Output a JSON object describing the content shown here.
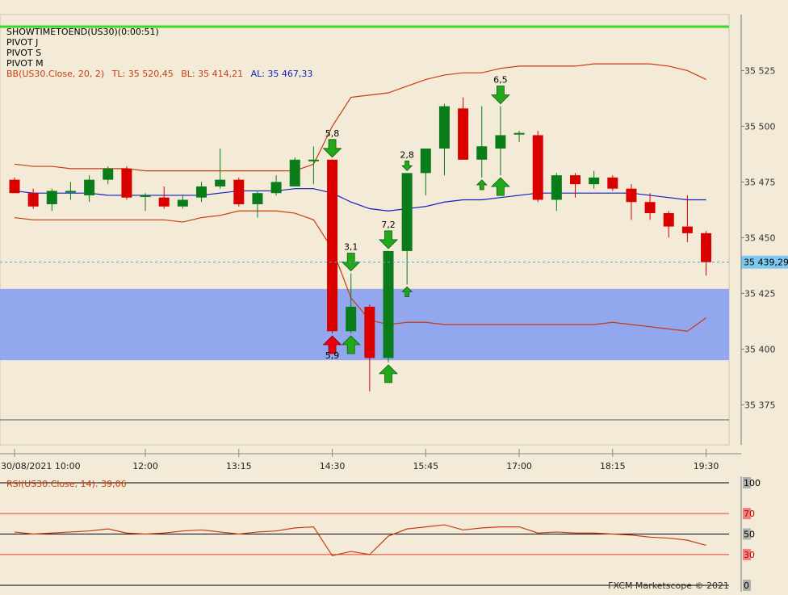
{
  "colors": {
    "background": "#f3ead7",
    "bull": "#0a7d1a",
    "bear": "#d90000",
    "bb": "#c83c10",
    "ma": "#1020c0",
    "zone": "#93a7ee",
    "top_line": "#33dd22",
    "rsi": "#c83c10",
    "price_badge": "#7ec8f0"
  },
  "header": {
    "line1": "SHOWTIMETOEND(US30)(0:00:51)",
    "line2": "PIVOT J",
    "line3": "PIVOT S",
    "line4": "PIVOT M",
    "bb_label": "BB(US30.Close, 20, 2)",
    "tl_label": "TL: 35 520,45",
    "bl_label": "BL: 35 414,21",
    "al_label": "AL: 35 467,33"
  },
  "current_price_label": "35 439,29",
  "watermark": "FXCM Marketscope © 2021",
  "chart_data": [
    {
      "type": "candlestick",
      "title": "",
      "x_tick_labels": [
        "30/08/2021 10:00",
        "12:00",
        "13:15",
        "14:30",
        "15:45",
        "17:00",
        "18:15",
        "19:30"
      ],
      "x_tick_candle_index": [
        0,
        7,
        12,
        17,
        22,
        27,
        32,
        37
      ],
      "y_ticks": [
        35375,
        35400,
        35425,
        35450,
        35475,
        35500,
        35525
      ],
      "y_tick_labels": [
        "35 375",
        "35 400",
        "35 425",
        "35 450",
        "35 475",
        "35 500",
        "35 525"
      ],
      "ylim": [
        35357,
        35544
      ],
      "grid": false,
      "candles": [
        {
          "o": 35476,
          "h": 35477,
          "l": 35470,
          "c": 35470
        },
        {
          "o": 35470,
          "h": 35472,
          "l": 35463,
          "c": 35464
        },
        {
          "o": 35465,
          "h": 35472,
          "l": 35462,
          "c": 35471
        },
        {
          "o": 35471,
          "h": 35475,
          "l": 35467,
          "c": 35471
        },
        {
          "o": 35469,
          "h": 35478,
          "l": 35466,
          "c": 35476
        },
        {
          "o": 35476,
          "h": 35482,
          "l": 35474,
          "c": 35481
        },
        {
          "o": 35481,
          "h": 35482,
          "l": 35467,
          "c": 35468
        },
        {
          "o": 35469,
          "h": 35470,
          "l": 35462,
          "c": 35469
        },
        {
          "o": 35468,
          "h": 35473,
          "l": 35463,
          "c": 35464
        },
        {
          "o": 35464,
          "h": 35469,
          "l": 35463,
          "c": 35467
        },
        {
          "o": 35468,
          "h": 35475,
          "l": 35466,
          "c": 35473
        },
        {
          "o": 35473,
          "h": 35490,
          "l": 35472,
          "c": 35476
        },
        {
          "o": 35476,
          "h": 35477,
          "l": 35464,
          "c": 35465
        },
        {
          "o": 35465,
          "h": 35471,
          "l": 35459,
          "c": 35470
        },
        {
          "o": 35470,
          "h": 35478,
          "l": 35469,
          "c": 35475
        },
        {
          "o": 35473,
          "h": 35486,
          "l": 35473,
          "c": 35485
        },
        {
          "o": 35485,
          "h": 35491,
          "l": 35474,
          "c": 35485
        },
        {
          "o": 35485,
          "h": 35485,
          "l": 35407,
          "c": 35408
        },
        {
          "o": 35408,
          "h": 35434,
          "l": 35407,
          "c": 35419
        },
        {
          "o": 35419,
          "h": 35420,
          "l": 35381,
          "c": 35396
        },
        {
          "o": 35396,
          "h": 35444,
          "l": 35394,
          "c": 35444
        },
        {
          "o": 35444,
          "h": 35479,
          "l": 35429,
          "c": 35479
        },
        {
          "o": 35479,
          "h": 35490,
          "l": 35469,
          "c": 35490
        },
        {
          "o": 35490,
          "h": 35510,
          "l": 35478,
          "c": 35509
        },
        {
          "o": 35508,
          "h": 35513,
          "l": 35485,
          "c": 35485
        },
        {
          "o": 35485,
          "h": 35509,
          "l": 35477,
          "c": 35491
        },
        {
          "o": 35490,
          "h": 35509,
          "l": 35478,
          "c": 35496
        },
        {
          "o": 35497,
          "h": 35498,
          "l": 35493,
          "c": 35497
        },
        {
          "o": 35496,
          "h": 35498,
          "l": 35466,
          "c": 35467
        },
        {
          "o": 35467,
          "h": 35479,
          "l": 35462,
          "c": 35478
        },
        {
          "o": 35478,
          "h": 35479,
          "l": 35468,
          "c": 35474
        },
        {
          "o": 35474,
          "h": 35480,
          "l": 35472,
          "c": 35477
        },
        {
          "o": 35477,
          "h": 35478,
          "l": 35471,
          "c": 35472
        },
        {
          "o": 35472,
          "h": 35474,
          "l": 35458,
          "c": 35466
        },
        {
          "o": 35466,
          "h": 35470,
          "l": 35458,
          "c": 35461
        },
        {
          "o": 35461,
          "h": 35462,
          "l": 35450,
          "c": 35455
        },
        {
          "o": 35455,
          "h": 35469,
          "l": 35448,
          "c": 35452
        },
        {
          "o": 35452,
          "h": 35453,
          "l": 35433,
          "c": 35439
        }
      ],
      "bb_upper": [
        35483,
        35482,
        35482,
        35481,
        35481,
        35481,
        35481,
        35480,
        35480,
        35480,
        35480,
        35480,
        35480,
        35480,
        35480,
        35480,
        35483,
        35500,
        35513,
        35514,
        35515,
        35518,
        35521,
        35523,
        35524,
        35524,
        35526,
        35527,
        35527,
        35527,
        35527,
        35528,
        35528,
        35528,
        35528,
        35527,
        35525,
        35521
      ],
      "bb_lower": [
        35459,
        35458,
        35458,
        35458,
        35458,
        35458,
        35458,
        35458,
        35458,
        35457,
        35459,
        35460,
        35462,
        35462,
        35462,
        35461,
        35458,
        35445,
        35423,
        35413,
        35411,
        35412,
        35412,
        35411,
        35411,
        35411,
        35411,
        35411,
        35411,
        35411,
        35411,
        35411,
        35412,
        35411,
        35410,
        35409,
        35408,
        35414
      ],
      "bb_middle": [
        35471,
        35470,
        35470,
        35470,
        35470,
        35469,
        35469,
        35469,
        35469,
        35469,
        35469,
        35470,
        35471,
        35471,
        35471,
        35472,
        35472,
        35470,
        35466,
        35463,
        35462,
        35463,
        35464,
        35466,
        35467,
        35467,
        35468,
        35469,
        35470,
        35470,
        35470,
        35470,
        35470,
        35470,
        35469,
        35468,
        35467,
        35467
      ],
      "blue_zone": [
        35395,
        35427
      ],
      "markers": [
        {
          "candle": 17,
          "dir": "down",
          "color": "green",
          "label": "5,8",
          "size": "large"
        },
        {
          "candle": 17,
          "dir": "up",
          "color": "red",
          "label": "5,9",
          "size": "large"
        },
        {
          "candle": 18,
          "dir": "down",
          "color": "green",
          "label": "3,1",
          "size": "large"
        },
        {
          "candle": 18,
          "dir": "up",
          "color": "green",
          "label": "",
          "size": "large"
        },
        {
          "candle": 20,
          "dir": "down",
          "color": "green",
          "label": "7,2",
          "size": "large"
        },
        {
          "candle": 20,
          "dir": "up",
          "color": "green",
          "label": "",
          "size": "large"
        },
        {
          "candle": 21,
          "dir": "down",
          "color": "green",
          "label": "2,8",
          "size": "small"
        },
        {
          "candle": 21,
          "dir": "up",
          "color": "green",
          "label": "",
          "size": "small"
        },
        {
          "candle": 25,
          "dir": "up",
          "color": "green",
          "label": "",
          "size": "small"
        },
        {
          "candle": 26,
          "dir": "down",
          "color": "green",
          "label": "6,5",
          "size": "large"
        },
        {
          "candle": 26,
          "dir": "up",
          "color": "green",
          "label": "",
          "size": "large"
        }
      ]
    },
    {
      "type": "line",
      "title": "RSI(US30.Close, 14): 39,06",
      "ylim": [
        0,
        100
      ],
      "y_ticks": [
        0,
        30,
        50,
        70,
        100
      ],
      "y_tick_labels": [
        "0",
        "30",
        "50",
        "70",
        "100"
      ],
      "values": [
        52,
        50,
        51,
        52,
        53,
        55,
        51,
        50,
        51,
        53,
        54,
        52,
        50,
        52,
        53,
        56,
        57,
        29,
        33,
        30,
        48,
        55,
        57,
        59,
        54,
        56,
        57,
        57,
        51,
        52,
        51,
        51,
        50,
        49,
        47,
        46,
        44,
        39
      ]
    }
  ]
}
